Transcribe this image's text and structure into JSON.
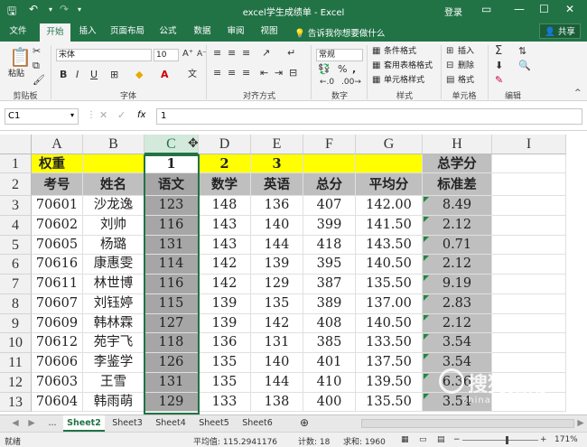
{
  "window": {
    "title": "excel学生成绩单 - Excel",
    "login": "登录",
    "controls": [
      "minimize-icon",
      "maximize-icon",
      "close-icon"
    ]
  },
  "menu": {
    "tabs": [
      "文件",
      "开始",
      "插入",
      "页面布局",
      "公式",
      "数据",
      "审阅",
      "视图"
    ],
    "active_tab": "开始",
    "tell_me": "告诉我你想要做什么",
    "share": "共享"
  },
  "ribbon": {
    "paste": "粘贴",
    "font_name": "宋体",
    "font_size": "10",
    "number_format": "常规",
    "conditional_format": "条件格式",
    "table_format": "套用表格格式",
    "cell_style": "单元格样式",
    "insert": "插入",
    "delete": "删除",
    "format": "格式",
    "groups": [
      "剪贴板",
      "字体",
      "对齐方式",
      "数字",
      "样式",
      "单元格",
      "编辑"
    ]
  },
  "formula_bar": {
    "name_box": "C1",
    "fx": "fx",
    "value": "1"
  },
  "columns": [
    "A",
    "B",
    "C",
    "D",
    "E",
    "F",
    "G",
    "H",
    "I"
  ],
  "selected_column": "C",
  "rows": [
    {
      "n": "1",
      "cells": [
        "权重",
        "",
        "1",
        "2",
        "3",
        "",
        "",
        "总学分"
      ]
    },
    {
      "n": "2",
      "cells": [
        "考号",
        "姓名",
        "语文",
        "数学",
        "英语",
        "总分",
        "平均分",
        "标准差"
      ]
    },
    {
      "n": "3",
      "cells": [
        "70601",
        "沙龙逸",
        "123",
        "148",
        "136",
        "407",
        "142.00",
        "8.49"
      ]
    },
    {
      "n": "4",
      "cells": [
        "70602",
        "刘帅",
        "116",
        "143",
        "140",
        "399",
        "141.50",
        "2.12"
      ]
    },
    {
      "n": "5",
      "cells": [
        "70605",
        "杨璐",
        "131",
        "143",
        "144",
        "418",
        "143.50",
        "0.71"
      ]
    },
    {
      "n": "6",
      "cells": [
        "70616",
        "康惠雯",
        "114",
        "142",
        "139",
        "395",
        "140.50",
        "2.12"
      ]
    },
    {
      "n": "7",
      "cells": [
        "70611",
        "林世博",
        "116",
        "142",
        "129",
        "387",
        "135.50",
        "9.19"
      ]
    },
    {
      "n": "8",
      "cells": [
        "70607",
        "刘钰婷",
        "115",
        "139",
        "135",
        "389",
        "137.00",
        "2.83"
      ]
    },
    {
      "n": "9",
      "cells": [
        "70609",
        "韩林霖",
        "127",
        "139",
        "142",
        "408",
        "140.50",
        "2.12"
      ]
    },
    {
      "n": "10",
      "cells": [
        "70612",
        "苑宇飞",
        "118",
        "136",
        "131",
        "385",
        "133.50",
        "3.54"
      ]
    },
    {
      "n": "11",
      "cells": [
        "70606",
        "李鉴学",
        "126",
        "135",
        "140",
        "401",
        "137.50",
        "3.54"
      ]
    },
    {
      "n": "12",
      "cells": [
        "70603",
        "王雪",
        "131",
        "135",
        "144",
        "410",
        "139.50",
        "6.36"
      ]
    },
    {
      "n": "13",
      "cells": [
        "70604",
        "韩雨萌",
        "129",
        "133",
        "138",
        "400",
        "135.50",
        "3.54"
      ]
    }
  ],
  "colors": {
    "excel_green": "#217346",
    "weight_row": "#ffff00",
    "gray_header": "#bfbfbf",
    "selected_col": "#a6a6a6"
  },
  "sheets": {
    "ellipsis": "...",
    "tabs": [
      "Sheet2",
      "Sheet3",
      "Sheet4",
      "Sheet5",
      "Sheet6"
    ],
    "active": "Sheet2"
  },
  "status": {
    "ready": "就绪",
    "average": "平均值: 115.2941176",
    "count": "计数: 18",
    "sum": "求和: 1960",
    "zoom": "171%"
  },
  "watermark": {
    "brand": "搜狗指南",
    "url": "zhinan.sogou.com"
  }
}
